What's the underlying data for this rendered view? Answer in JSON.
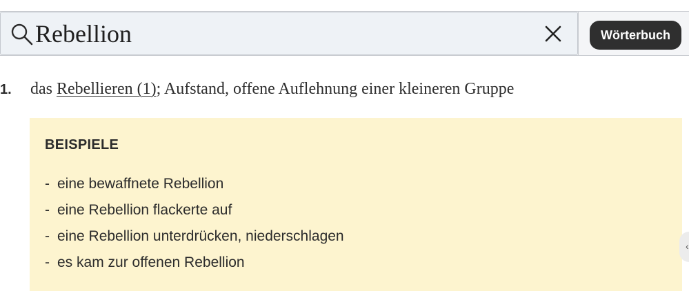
{
  "search": {
    "value": "Rebellion",
    "clear_icon": "close-icon",
    "search_icon": "search-icon"
  },
  "toolbar": {
    "dictionary_button_label": "Wörterbuch"
  },
  "definition": {
    "number": "1.",
    "prefix": "das ",
    "link_text": "Rebellieren (1)",
    "suffix": "; Aufstand, offene Auflehnung einer kleineren Gruppe"
  },
  "examples": {
    "title": "BEISPIELE",
    "items": [
      "eine bewaffnete Rebellion",
      "eine Rebellion flackerte auf",
      "eine Rebellion unterdrücken, niederschlagen",
      "es kam zur offenen Rebellion"
    ],
    "bullet": "-"
  },
  "colors": {
    "examples_background": "#fdf4cf",
    "button_background": "#2f2f2f",
    "search_background": "#eef2f6"
  }
}
